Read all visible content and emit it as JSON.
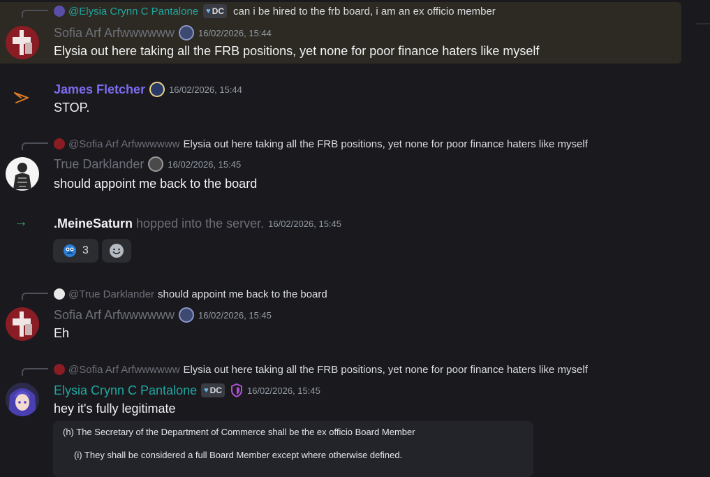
{
  "colors": {
    "background": "#1a1a1e",
    "highlight": "#2c2a22",
    "james_name": "#7c6cf0",
    "elysia_name": "#1fa6a0",
    "join_arrow": "#3ba55d",
    "muted": "#6d6f78"
  },
  "messages": {
    "m1": {
      "reply_name": "@Elysia Crynn C Pantalone",
      "reply_tag": "DC",
      "reply_text": "can i be hired to the frb board, i am an ex officio member",
      "author": "Sofia Arf Arfwwwwww",
      "timestamp": "16/02/2026, 15:44",
      "text": "Elysia out here taking all the FRB positions, yet none for poor finance haters like myself"
    },
    "m2": {
      "author": "James Fletcher",
      "timestamp": "16/02/2026, 15:44",
      "text": "STOP."
    },
    "m3": {
      "reply_name": "@Sofia Arf Arfwwwwww",
      "reply_text": "Elysia out here taking all the FRB positions, yet none for poor finance haters like myself",
      "author": "True Darklander",
      "timestamp": "16/02/2026, 15:45",
      "text": "should appoint me back to the board"
    },
    "join": {
      "user": ".MeineSaturn",
      "text": "hopped into the server.",
      "timestamp": "16/02/2026, 15:45",
      "reaction_count": "3"
    },
    "m4": {
      "reply_name": "@True Darklander",
      "reply_text": "should appoint me back to the board",
      "author": "Sofia Arf Arfwwwwww",
      "timestamp": "16/02/2026, 15:45",
      "text": "Eh"
    },
    "m5": {
      "reply_name": "@Sofia Arf Arfwwwwww",
      "reply_text": "Elysia out here taking all the FRB positions, yet none for poor finance haters like myself",
      "author": "Elysia Crynn C Pantalone",
      "tag": "DC",
      "timestamp": "16/02/2026, 15:45",
      "text": "hey it's fully legitimate",
      "embed_line1": "(h) The Secretary of the Department of Commerce shall be the ex officio Board Member",
      "embed_line2": "(i) They shall be considered a full Board Member except where otherwise defined."
    }
  }
}
